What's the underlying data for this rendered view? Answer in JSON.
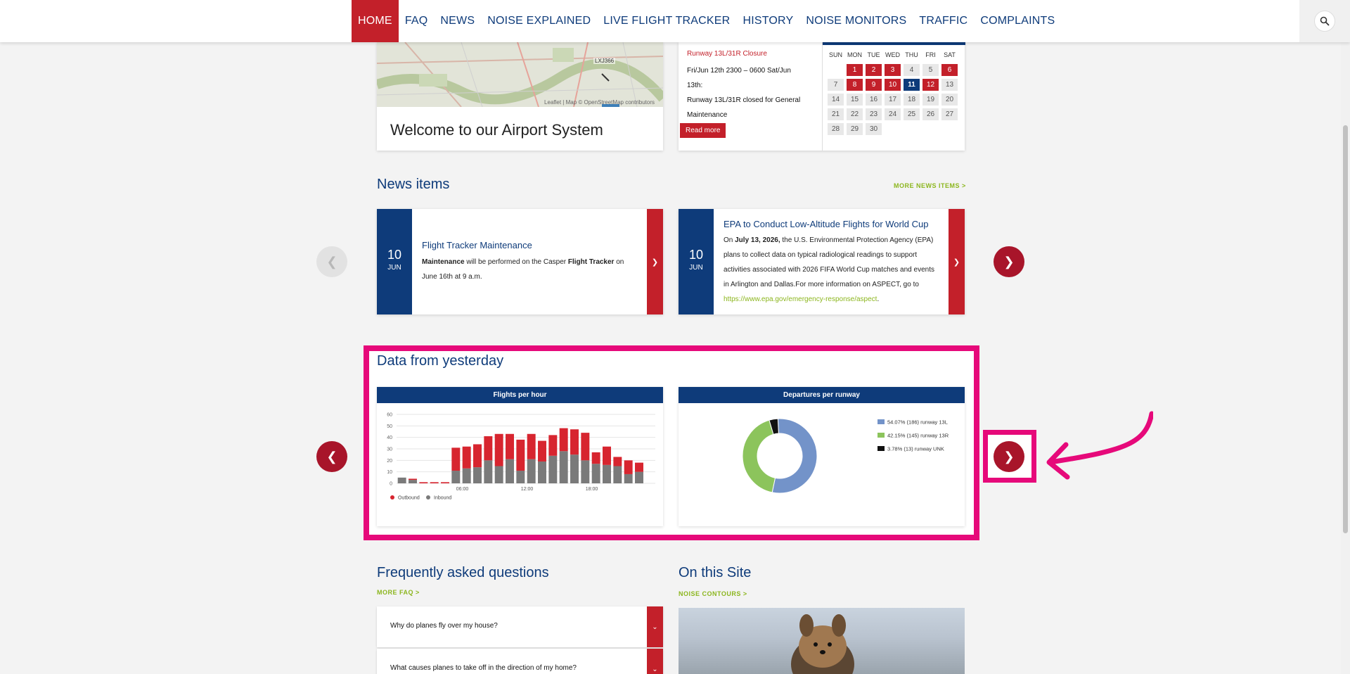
{
  "nav": {
    "items": [
      "HOME",
      "FAQ",
      "NEWS",
      "NOISE EXPLAINED",
      "LIVE FLIGHT TRACKER",
      "HISTORY",
      "NOISE MONITORS",
      "TRAFFIC",
      "COMPLAINTS"
    ],
    "active": "HOME",
    "search_icon": "search-icon"
  },
  "map_card": {
    "caption": "Welcome to our Airport System",
    "flight_label": "LXJ366",
    "attribution": "Leaflet | Map © OpenStreetMap contributors"
  },
  "notice": {
    "title": "Runway 13L/31R Closure",
    "line1": "Fri/Jun 12th 2300 – 0600 Sat/Jun 13th:",
    "line2": "Runway 13L/31R closed for General Maintenance",
    "button": "Read more"
  },
  "calendar": {
    "headers": [
      "SUN",
      "MON",
      "TUE",
      "WED",
      "THU",
      "FRI",
      "SAT"
    ],
    "weeks": [
      [
        "",
        "1",
        "2",
        "3",
        "4",
        "5",
        "6"
      ],
      [
        "7",
        "8",
        "9",
        "10",
        "11",
        "12",
        "13"
      ],
      [
        "14",
        "15",
        "16",
        "17",
        "18",
        "19",
        "20"
      ],
      [
        "21",
        "22",
        "23",
        "24",
        "25",
        "26",
        "27"
      ],
      [
        "28",
        "29",
        "30",
        "",
        "",
        "",
        ""
      ]
    ],
    "red_days": [
      "1",
      "2",
      "3",
      "6",
      "8",
      "9",
      "10",
      "12"
    ],
    "blue_days": [
      "11"
    ]
  },
  "news": {
    "title": "News items",
    "more": "MORE NEWS ITEMS >",
    "items": [
      {
        "day": "10",
        "month": "JUN",
        "headline": "Flight Tracker Maintenance",
        "text_parts": [
          "Maintenance",
          " will be performed on the Casper ",
          "Flight Tracker",
          " on June 16th at 9 a.m."
        ]
      },
      {
        "day": "10",
        "month": "JUN",
        "headline": "EPA to Conduct Low-Altitude Flights for World Cup",
        "text_parts": [
          "On ",
          "July 13, 2026,",
          " the U.S. Environmental Protection Agency (EPA) plans to collect data on typical radiological readings to support activities associated with 2026 FIFA World Cup matches and events in Arlington and Dallas.For more information on ASPECT, go to "
        ],
        "link": "https://www.epa.gov/emergency-response/aspect",
        "link_suffix": "."
      }
    ]
  },
  "data_section": {
    "title": "Data from yesterday",
    "flights_title": "Flights per hour",
    "departures_title": "Departures per runway"
  },
  "chart_data": [
    {
      "type": "bar",
      "title": "Flights per hour",
      "stacked": true,
      "x": [
        0,
        1,
        2,
        3,
        4,
        5,
        6,
        7,
        8,
        9,
        10,
        11,
        12,
        13,
        14,
        15,
        16,
        17,
        18,
        19,
        20,
        21,
        22,
        23
      ],
      "x_tick_labels": [
        "06:00",
        "12:00",
        "18:00"
      ],
      "x_tick_positions": [
        6,
        12,
        18
      ],
      "ylim": [
        0,
        60
      ],
      "yticks": [
        0,
        10,
        20,
        30,
        40,
        50,
        60
      ],
      "series": [
        {
          "name": "Inbound",
          "color": "#7a7a7a",
          "values": [
            5,
            3,
            0,
            0,
            0,
            11,
            13,
            14,
            20,
            15,
            21,
            11,
            21,
            19,
            24,
            28,
            25,
            20,
            17,
            16,
            15,
            8,
            10,
            0
          ]
        },
        {
          "name": "Outbound",
          "color": "#d7252f",
          "values": [
            0,
            1,
            1,
            1,
            1,
            20,
            19,
            20,
            21,
            28,
            22,
            27,
            22,
            18,
            18,
            20,
            22,
            24,
            10,
            16,
            8,
            12,
            8,
            0
          ]
        }
      ],
      "legend": [
        "Outbound",
        "Inbound"
      ],
      "grid": true
    },
    {
      "type": "pie",
      "title": "Departures per runway",
      "donut": true,
      "labels": [
        "runway 13L",
        "runway 13R",
        "runway UNK"
      ],
      "values": [
        186,
        145,
        13
      ],
      "percentages": [
        54.07,
        42.15,
        3.78
      ],
      "legend_entries": [
        "54.07% (186) runway 13L",
        "42.15% (145) runway 13R",
        "3.78% (13) runway UNK"
      ],
      "colors": [
        "#7393c9",
        "#8cc45c",
        "#111111"
      ],
      "legend_position": "top-right"
    }
  ],
  "faq": {
    "title": "Frequently asked questions",
    "more": "MORE FAQ >",
    "items": [
      "Why do planes fly over my house?",
      "What causes planes to take off in the direction of my home?"
    ]
  },
  "site": {
    "title": "On this Site",
    "more": "NOISE CONTOURS >"
  }
}
